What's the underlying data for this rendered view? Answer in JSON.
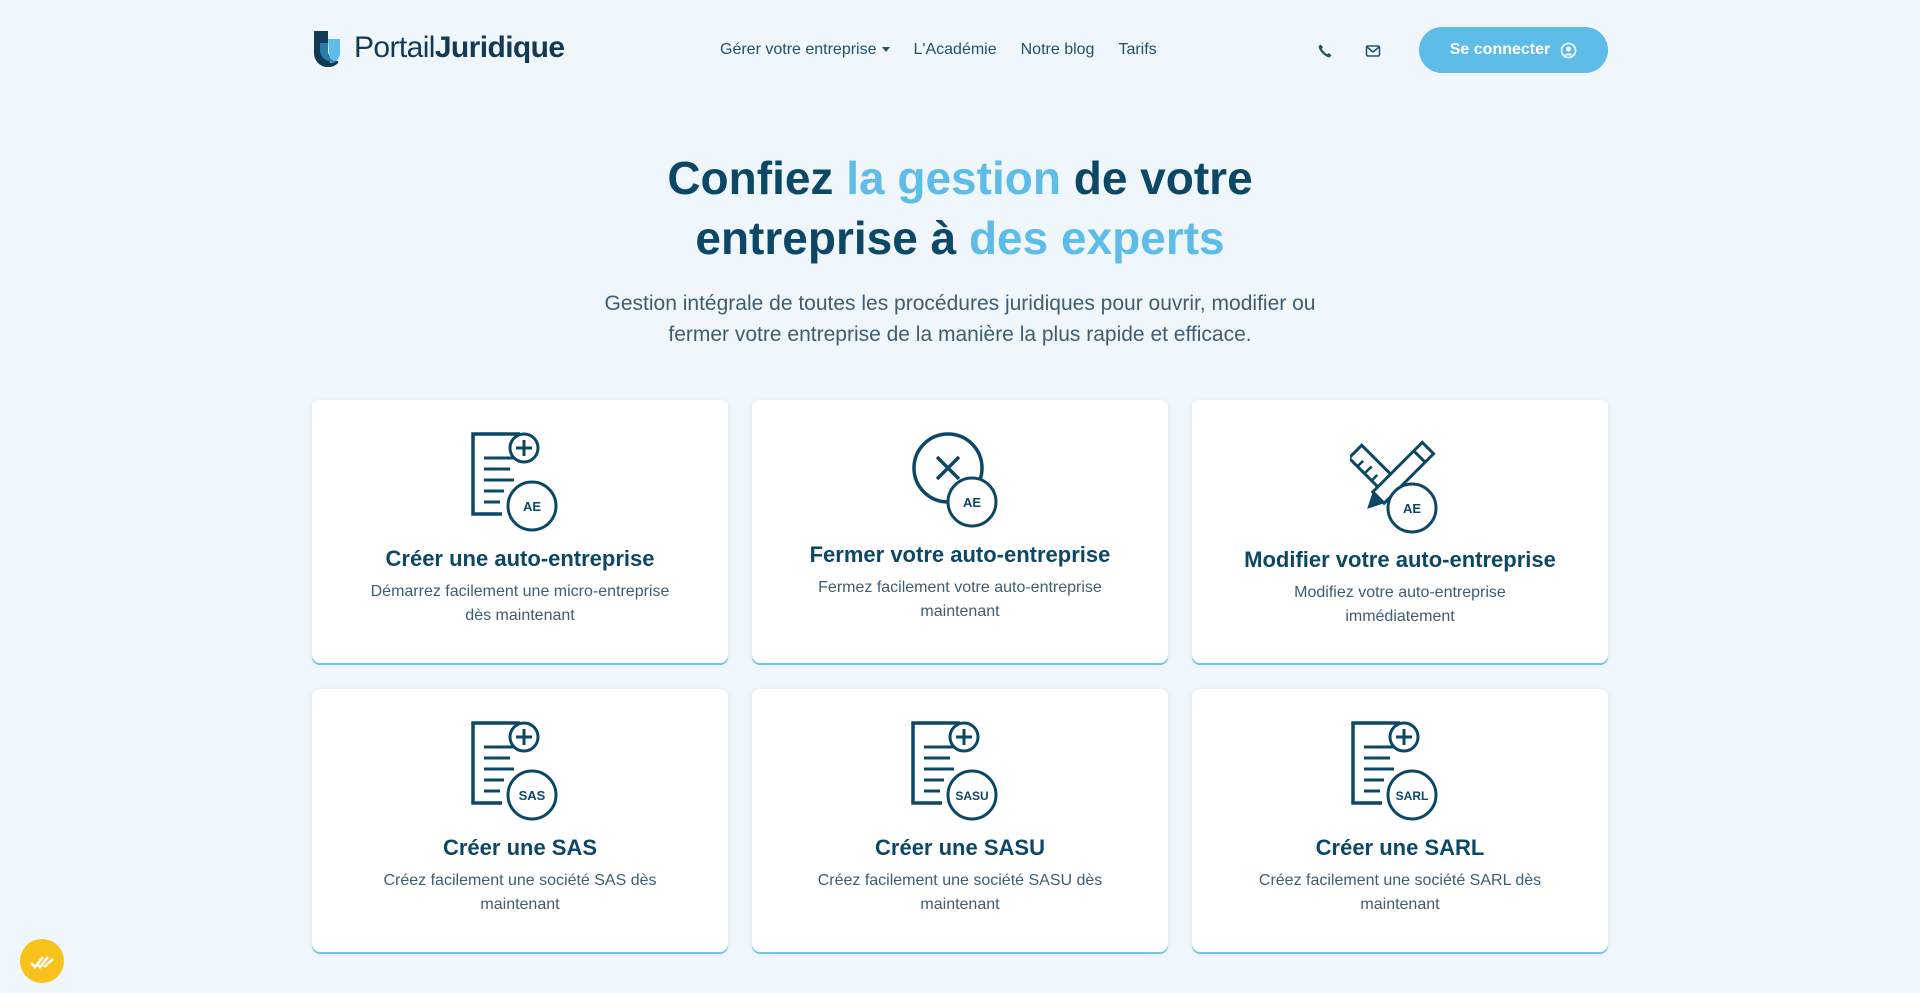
{
  "header": {
    "logo_light": "Portail",
    "logo_bold": "Juridique",
    "nav": [
      {
        "label": "Gérer votre entreprise",
        "dropdown": true
      },
      {
        "label": "L'Académie"
      },
      {
        "label": "Notre blog"
      },
      {
        "label": "Tarifs"
      }
    ],
    "phone_icon": "phone-icon",
    "mail_icon": "mail-icon",
    "login_label": "Se connecter",
    "login_icon": "user-circle-icon"
  },
  "hero": {
    "title_1": "Confiez ",
    "title_2": "la gestion",
    "title_3": " de votre",
    "title_4": "entreprise à ",
    "title_5": "des experts",
    "subtitle_1": "Gestion intégrale de toutes les procédures juridiques pour ouvrir, modifier ou",
    "subtitle_2": "fermer votre entreprise de la manière la plus rapide et efficace."
  },
  "cards": [
    {
      "title": "Créer une auto-entreprise",
      "desc": "Démarrez facilement une micro-entreprise dès maintenant",
      "badge": "AE",
      "icon": "document-add-icon"
    },
    {
      "title": "Fermer votre auto-entreprise",
      "desc": "Fermez facilement votre auto-entreprise maintenant",
      "badge": "AE",
      "icon": "close-circle-icon"
    },
    {
      "title": "Modifier votre auto-entreprise",
      "desc": "Modifiez votre auto-entreprise immédiatement",
      "badge": "AE",
      "icon": "pencil-ruler-icon"
    },
    {
      "title": "Créer une SAS",
      "desc": "Créez facilement une société SAS dès maintenant",
      "badge": "SAS",
      "icon": "document-add-icon"
    },
    {
      "title": "Créer une SASU",
      "desc": "Créez facilement une société SASU dès maintenant",
      "badge": "SASU",
      "icon": "document-add-icon"
    },
    {
      "title": "Créer une SARL",
      "desc": "Créez facilement une société SARL dès maintenant",
      "badge": "SARL",
      "icon": "document-add-icon"
    }
  ],
  "colors": {
    "primary": "#0c4766",
    "accent": "#5ebce9",
    "background": "#eff6fc",
    "fab": "#f6c21b"
  },
  "fab_icon": "checkmarks-icon"
}
